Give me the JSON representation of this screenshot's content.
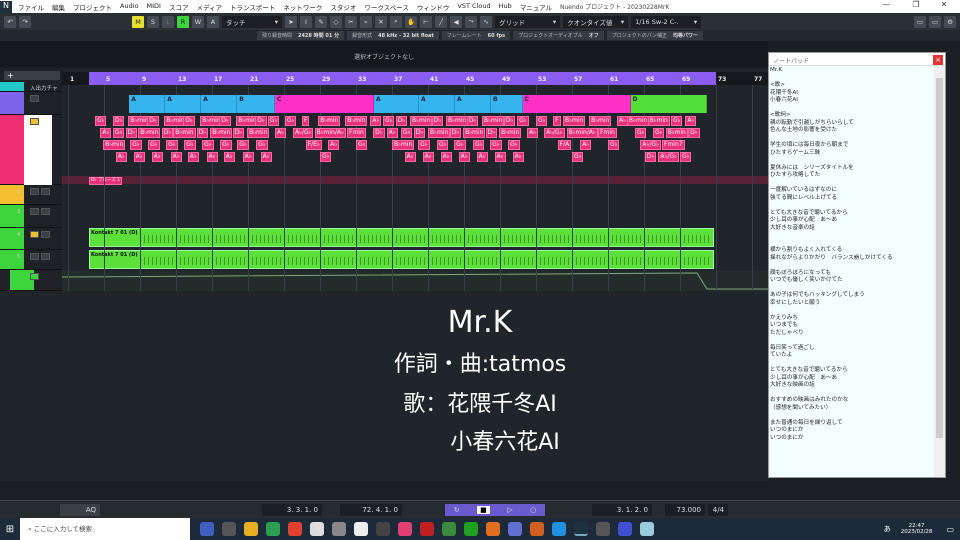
{
  "menubar": {
    "items": [
      "ファイル",
      "編集",
      "プロジェクト",
      "Audio",
      "MIDI",
      "スコア",
      "メディア",
      "トランスポート",
      "ネットワーク",
      "スタジオ",
      "ワークスペース",
      "ウィンドウ",
      "VST Cloud",
      "Hub",
      "マニュアル"
    ]
  },
  "window": {
    "title": "Nuendo プロジェクト - 20230228MrK",
    "minimize": "—",
    "maximize": "❐",
    "close": "✕"
  },
  "toolbar": {
    "undo": "↶",
    "redo": "↷",
    "m": "M",
    "s": "S",
    "l": "L",
    "r": "R",
    "w": "W",
    "a": "A",
    "automation_mode": "タッチ",
    "snap_type": "グリッド",
    "quantize_label": "クオンタイズ値",
    "quantize_value": "1/16 Sw-2 C-."
  },
  "status": [
    {
      "label": "残り録音時間",
      "value": "2428 時間 01 分"
    },
    {
      "label": "録音形式",
      "value": "48 kHz - 32 bit float"
    },
    {
      "label": "フレームレート",
      "value": "60 fps"
    },
    {
      "label": "プロジェクトオーディオプル",
      "value": "オフ"
    },
    {
      "label": "プロジェクトのパン補正",
      "value": "均等パワー"
    }
  ],
  "info_line": "選択オブジェクトなし",
  "tracklist": {
    "folder_label": "入出力チャ",
    "tracks": [
      "1",
      "3",
      "4",
      "5"
    ]
  },
  "ruler": {
    "bars": [
      1,
      5,
      9,
      13,
      17,
      21,
      25,
      29,
      33,
      37,
      41,
      45,
      49,
      53,
      57,
      61,
      65,
      69,
      73,
      77
    ],
    "project_end_bar": 72
  },
  "arranger": [
    {
      "label": "A",
      "start": 7.8,
      "end": 11.8,
      "color": "#35b4f0"
    },
    {
      "label": "A",
      "start": 11.8,
      "end": 15.8,
      "color": "#35b4f0"
    },
    {
      "label": "A",
      "start": 15.8,
      "end": 19.8,
      "color": "#35b4f0"
    },
    {
      "label": "B",
      "start": 19.8,
      "end": 24,
      "color": "#35b4f0"
    },
    {
      "label": "C",
      "start": 24,
      "end": 35,
      "color": "#ff30c8"
    },
    {
      "label": "A",
      "start": 35,
      "end": 40,
      "color": "#35b4f0"
    },
    {
      "label": "A",
      "start": 40,
      "end": 44,
      "color": "#35b4f0"
    },
    {
      "label": "A",
      "start": 44,
      "end": 48,
      "color": "#35b4f0"
    },
    {
      "label": "B",
      "start": 48,
      "end": 51.5,
      "color": "#35b4f0"
    },
    {
      "label": "C",
      "start": 51.5,
      "end": 63.5,
      "color": "#ff30c8"
    },
    {
      "label": "D",
      "start": 63.5,
      "end": 72,
      "color": "#52e038"
    }
  ],
  "chords": [
    [
      [
        4,
        "G♭"
      ],
      [
        6,
        "D♭"
      ],
      [
        7.7,
        "B♭min"
      ],
      [
        9.8,
        "D♭"
      ],
      [
        11.7,
        "B♭min"
      ],
      [
        13.8,
        "D♭"
      ],
      [
        15.7,
        "B♭min"
      ],
      [
        17.8,
        "D♭"
      ],
      [
        19.7,
        "B♭min"
      ],
      [
        21.8,
        "D♭"
      ],
      [
        23.2,
        "G♭"
      ],
      [
        25.1,
        "G♭"
      ],
      [
        27,
        "F"
      ],
      [
        28.8,
        "B♭min"
      ],
      [
        31.8,
        "B♭min"
      ],
      [
        34.6,
        "A♭"
      ],
      [
        36,
        "G♭"
      ],
      [
        37.4,
        "D♭"
      ],
      [
        39,
        "B♭min"
      ],
      [
        41.4,
        "D♭"
      ],
      [
        43,
        "B♭min"
      ],
      [
        45.3,
        "D♭"
      ],
      [
        47,
        "B♭min"
      ],
      [
        49.4,
        "D♭"
      ],
      [
        50.9,
        "G♭"
      ],
      [
        53,
        "G♭"
      ],
      [
        54.9,
        "F"
      ],
      [
        56,
        "B♭min"
      ],
      [
        58.9,
        "B♭min"
      ],
      [
        62,
        "A♭"
      ],
      [
        63.1,
        "B♭min"
      ],
      [
        65.4,
        "B♭min"
      ],
      [
        68,
        "G♭"
      ],
      [
        69.6,
        "A♭"
      ]
    ],
    [
      [
        4.6,
        "A♭"
      ],
      [
        6,
        "G♭"
      ],
      [
        7.4,
        "D♭"
      ],
      [
        8.8,
        "B♭min"
      ],
      [
        11.4,
        "D♭"
      ],
      [
        12.7,
        "B♭min"
      ],
      [
        15.3,
        "D♭"
      ],
      [
        16.8,
        "B♭min"
      ],
      [
        19.3,
        "D♭"
      ],
      [
        20.9,
        "B♭min"
      ],
      [
        24,
        "A♭"
      ],
      [
        26,
        "A♭/G♭"
      ],
      [
        28.4,
        "B♭min/A♭"
      ],
      [
        32,
        "Fmin"
      ],
      [
        34.9,
        "D♭"
      ],
      [
        36.4,
        "A♭"
      ],
      [
        38,
        "G♭"
      ],
      [
        39.4,
        "D♭"
      ],
      [
        41,
        "B♭min"
      ],
      [
        43.4,
        "D♭"
      ],
      [
        44.9,
        "B♭min"
      ],
      [
        47.4,
        "D♭"
      ],
      [
        48.9,
        "B♭min"
      ],
      [
        52,
        "A♭"
      ],
      [
        53.9,
        "A♭/G♭"
      ],
      [
        56.4,
        "B♭min/A♭"
      ],
      [
        59.9,
        "Fmin"
      ],
      [
        64,
        "G♭"
      ],
      [
        66,
        "G♭"
      ],
      [
        67.4,
        "B♭min"
      ],
      [
        69.9,
        "D♭"
      ]
    ],
    [
      [
        4.9,
        "B♭min"
      ],
      [
        7.9,
        "G♭"
      ],
      [
        9.9,
        "G♭"
      ],
      [
        11.9,
        "G♭"
      ],
      [
        13.9,
        "G♭"
      ],
      [
        15.9,
        "G♭"
      ],
      [
        17.9,
        "G♭"
      ],
      [
        19.8,
        "G♭"
      ],
      [
        21.9,
        "G♭"
      ],
      [
        27.4,
        "F/E♭"
      ],
      [
        29.9,
        "A♭"
      ],
      [
        33,
        "G♭"
      ],
      [
        37,
        "B♭min"
      ],
      [
        39.9,
        "G♭"
      ],
      [
        42,
        "G♭"
      ],
      [
        43.9,
        "G♭"
      ],
      [
        46,
        "G♭"
      ],
      [
        47.9,
        "G♭"
      ],
      [
        49.9,
        "G♭"
      ],
      [
        55.4,
        "F/A"
      ],
      [
        57.9,
        "A♭"
      ],
      [
        61,
        "G♭"
      ],
      [
        64.6,
        "A♭/G♭"
      ],
      [
        67,
        "Fmin7"
      ]
    ],
    [
      [
        6.3,
        "A♭"
      ],
      [
        8.3,
        "A♭"
      ],
      [
        10.3,
        "A♭"
      ],
      [
        12.4,
        "A♭"
      ],
      [
        14.3,
        "A♭"
      ],
      [
        16.4,
        "A♭"
      ],
      [
        18.3,
        "A♭"
      ],
      [
        20.4,
        "A♭"
      ],
      [
        22.4,
        "A♭"
      ],
      [
        29,
        "G♭"
      ],
      [
        38.4,
        "A♭"
      ],
      [
        40.4,
        "A♭"
      ],
      [
        42.4,
        "A♭"
      ],
      [
        44.4,
        "A♭"
      ],
      [
        46.4,
        "A♭"
      ],
      [
        48.4,
        "A♭"
      ],
      [
        50.4,
        "A♭"
      ],
      [
        57,
        "G♭"
      ],
      [
        65.1,
        "D♭"
      ],
      [
        66.6,
        "A♭/G♭"
      ],
      [
        69,
        "G♭"
      ]
    ]
  ],
  "scale_event": "D♭ ブルース 1",
  "parts": [
    {
      "label": "Kontakt 7 01 (D)"
    },
    {
      "label": "Kontakt 7 01 (D)"
    }
  ],
  "overlay": {
    "title": "Mr.K",
    "credit": "作詞・曲:tatmos",
    "vocal_line1": "歌：花隈千冬AI",
    "vocal_line2": "小春六花AI"
  },
  "notepad": {
    "title": "ノートパッド",
    "close": "×",
    "text": "Mr.K\n\n<歌>\n花隈千冬AI\n小春六花AI\n\n<歌詞>\n親の転勤で引越しがちらいらして\n色んな土地の影響を受けた\n\n学生の頃には毎日夜から朝まで\nひたすらゲーム三昧\n\n夏休みには　シリーズタイトルを\nひたすら攻略してた\n\n一度解いているはずなのに\n強てる間にレベル上げてる\n\nとても大きな音で聴いてるから\n少し耳の事が心配　あ～あ\n大好きな音楽の話\n\n\n横から割りもよく入れてくる\n揺れながらよりかかり　バランス崩しかけてくる\n\n顔もぼろぼろになっても\nいつでも優しく笑いかけてた\n\nあの子は何でもハッキングしてしまう\n幸せにしたいと願う\n\nかえりみち\nいつまでも\nただしゃべり\n\n毎日笑って過ごし\nていたよ\n\nとても大きな音で聴いてるから\n少し耳の事が心配　あ～あ\n大好きな映画の話\n\nおすすめの映画はみれたのかな\n（感想を聞いてみたい）\n\nまた普通の毎日を繰り返して\nいつのまにか\nいつのまにか"
  },
  "transport": {
    "left_locator": "3. 3. 1.   0",
    "right_locator": "72. 4. 1.   0",
    "position": "3. 1. 2.   0",
    "tempo": "73.000",
    "signature": "4/4",
    "aq": "AQ"
  },
  "taskbar": {
    "search_placeholder": "ここに入力して検索",
    "time": "22:47",
    "date": "2023/02/28",
    "ime": "あ"
  },
  "colors": {
    "ruler_bar": "#8a5cf0",
    "chord": "#e8307a",
    "part": "#5ce03a",
    "arranger_track": "#7b62e8",
    "folder": "#22c8c8"
  }
}
